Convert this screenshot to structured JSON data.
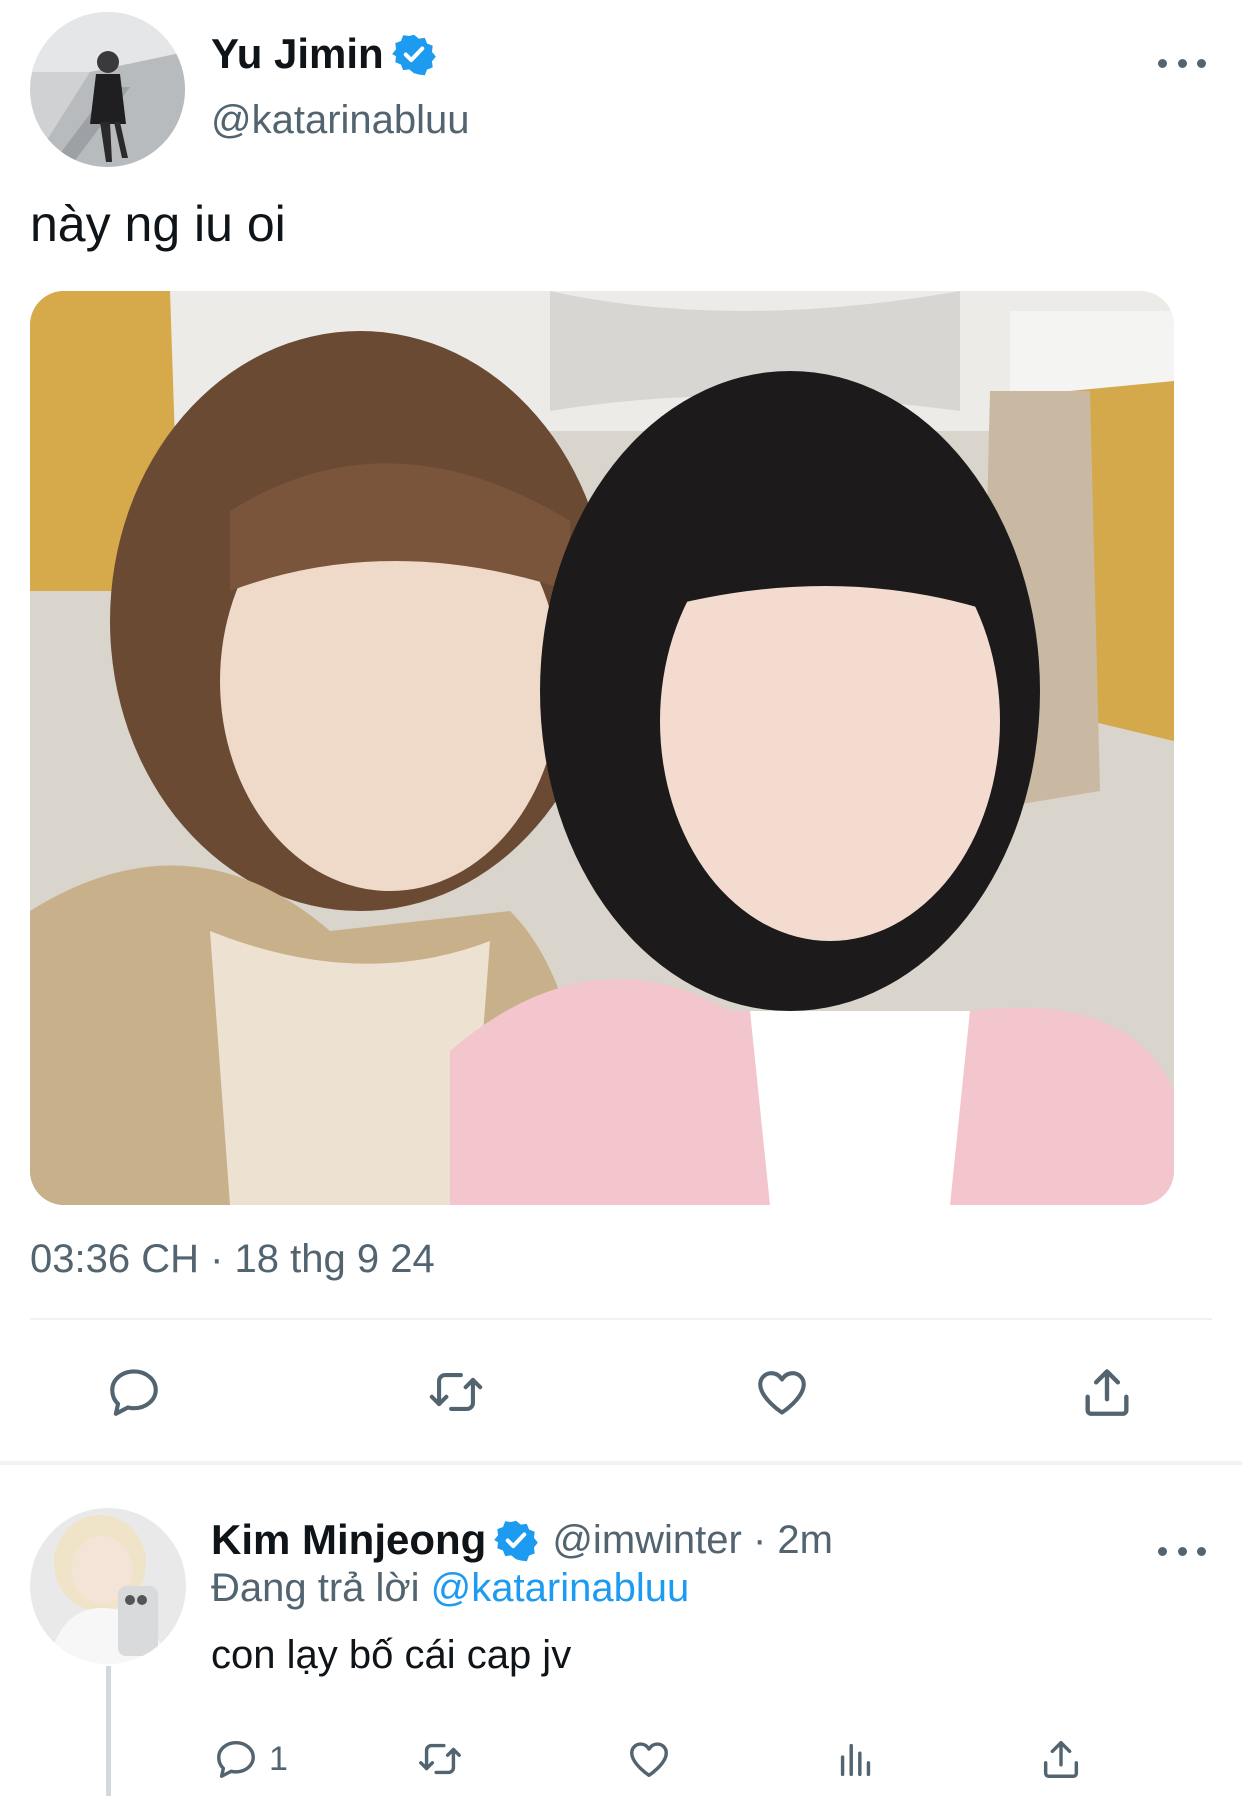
{
  "colors": {
    "accent": "#1d9bf0",
    "text_primary": "#0f1419",
    "text_secondary": "#536471",
    "divider": "#eff3f4"
  },
  "tweet": {
    "author_name": "Yu Jimin",
    "handle": "@katarinabluu",
    "verified_icon": "verified-badge-icon",
    "text": "này ng iu oi",
    "timestamp": "03:36 CH · 18 thg 9 24",
    "actions": [
      "reply-icon",
      "retweet-icon",
      "like-icon",
      "share-icon"
    ]
  },
  "reply": {
    "author_name": "Kim Minjeong",
    "handle_meta": "@imwinter · 2m",
    "replying_prefix": "Đang trả lời",
    "replying_mention": "@katarinabluu",
    "text": "con lạy bố cái cap jv",
    "reply_count": "1",
    "actions": [
      "reply-icon",
      "retweet-icon",
      "like-icon",
      "views-icon",
      "share-icon"
    ]
  }
}
